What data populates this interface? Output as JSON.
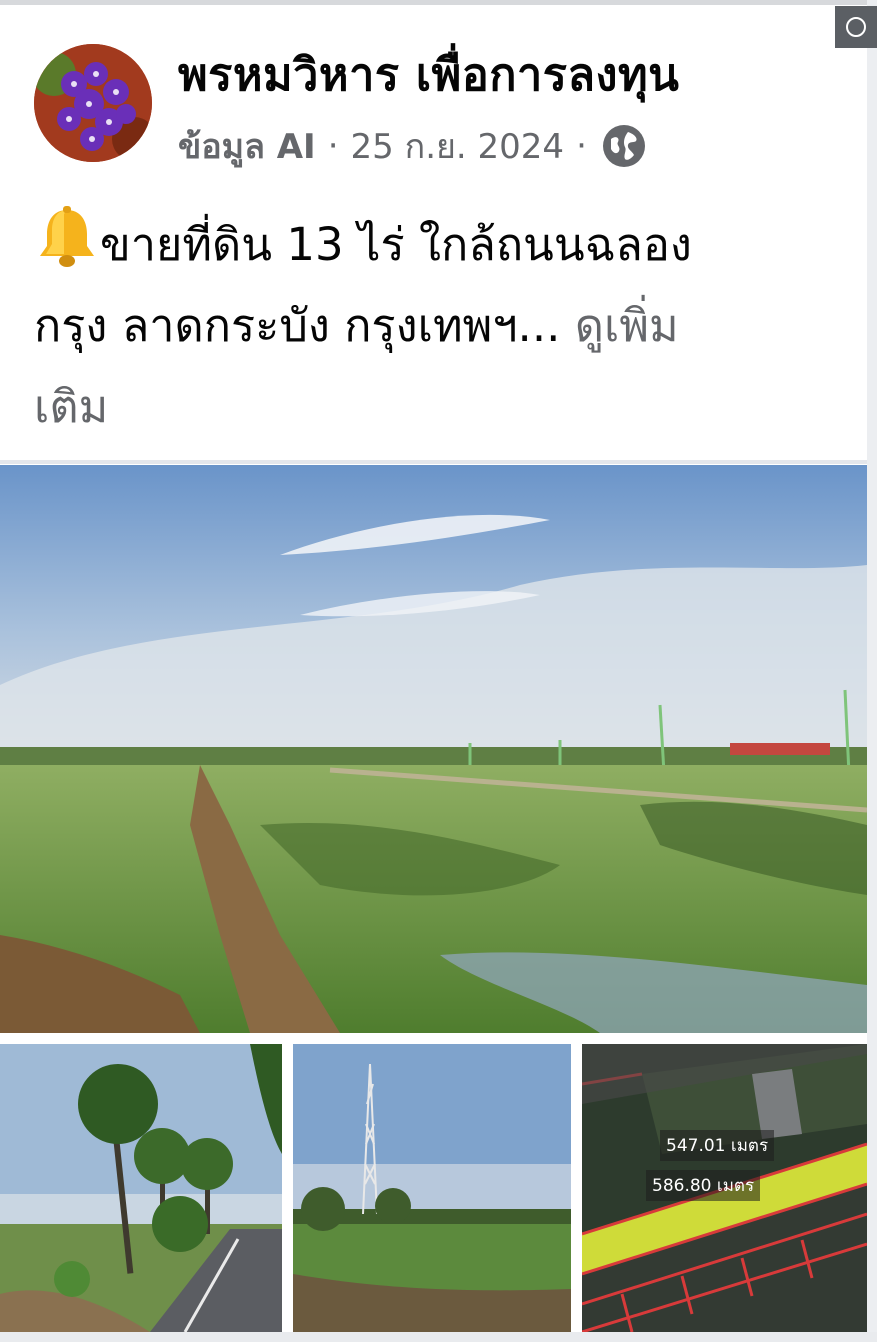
{
  "post": {
    "page_name": "พรหมวิหาร เพื่อการลงทุน",
    "author_label": "ข้อมูล AI",
    "separator": "·",
    "date": "25 ก.ย. 2024",
    "audience_icon": "globe-icon",
    "caption_icon": "bell-icon",
    "caption_line1": "ขายที่ดิน 13 ไร่ ใกล้ถนนฉลอง",
    "caption_line2": "กรุง ลาดกระบัง กรุงเทพฯ...",
    "see_more": "ดูเพิ่ม",
    "see_more_line2": "เติม"
  },
  "photos": {
    "main": "rice-field-photo",
    "thumbs": [
      "palm-trees-roadside-photo",
      "cell-tower-field-photo",
      "satellite-map-photo"
    ]
  },
  "map": {
    "label_width": "547.01 เมตร",
    "label_length": "586.80 เมตร"
  },
  "colors": {
    "text_primary": "#050505",
    "text_secondary": "#65676b",
    "divider": "#e4e6eb"
  }
}
